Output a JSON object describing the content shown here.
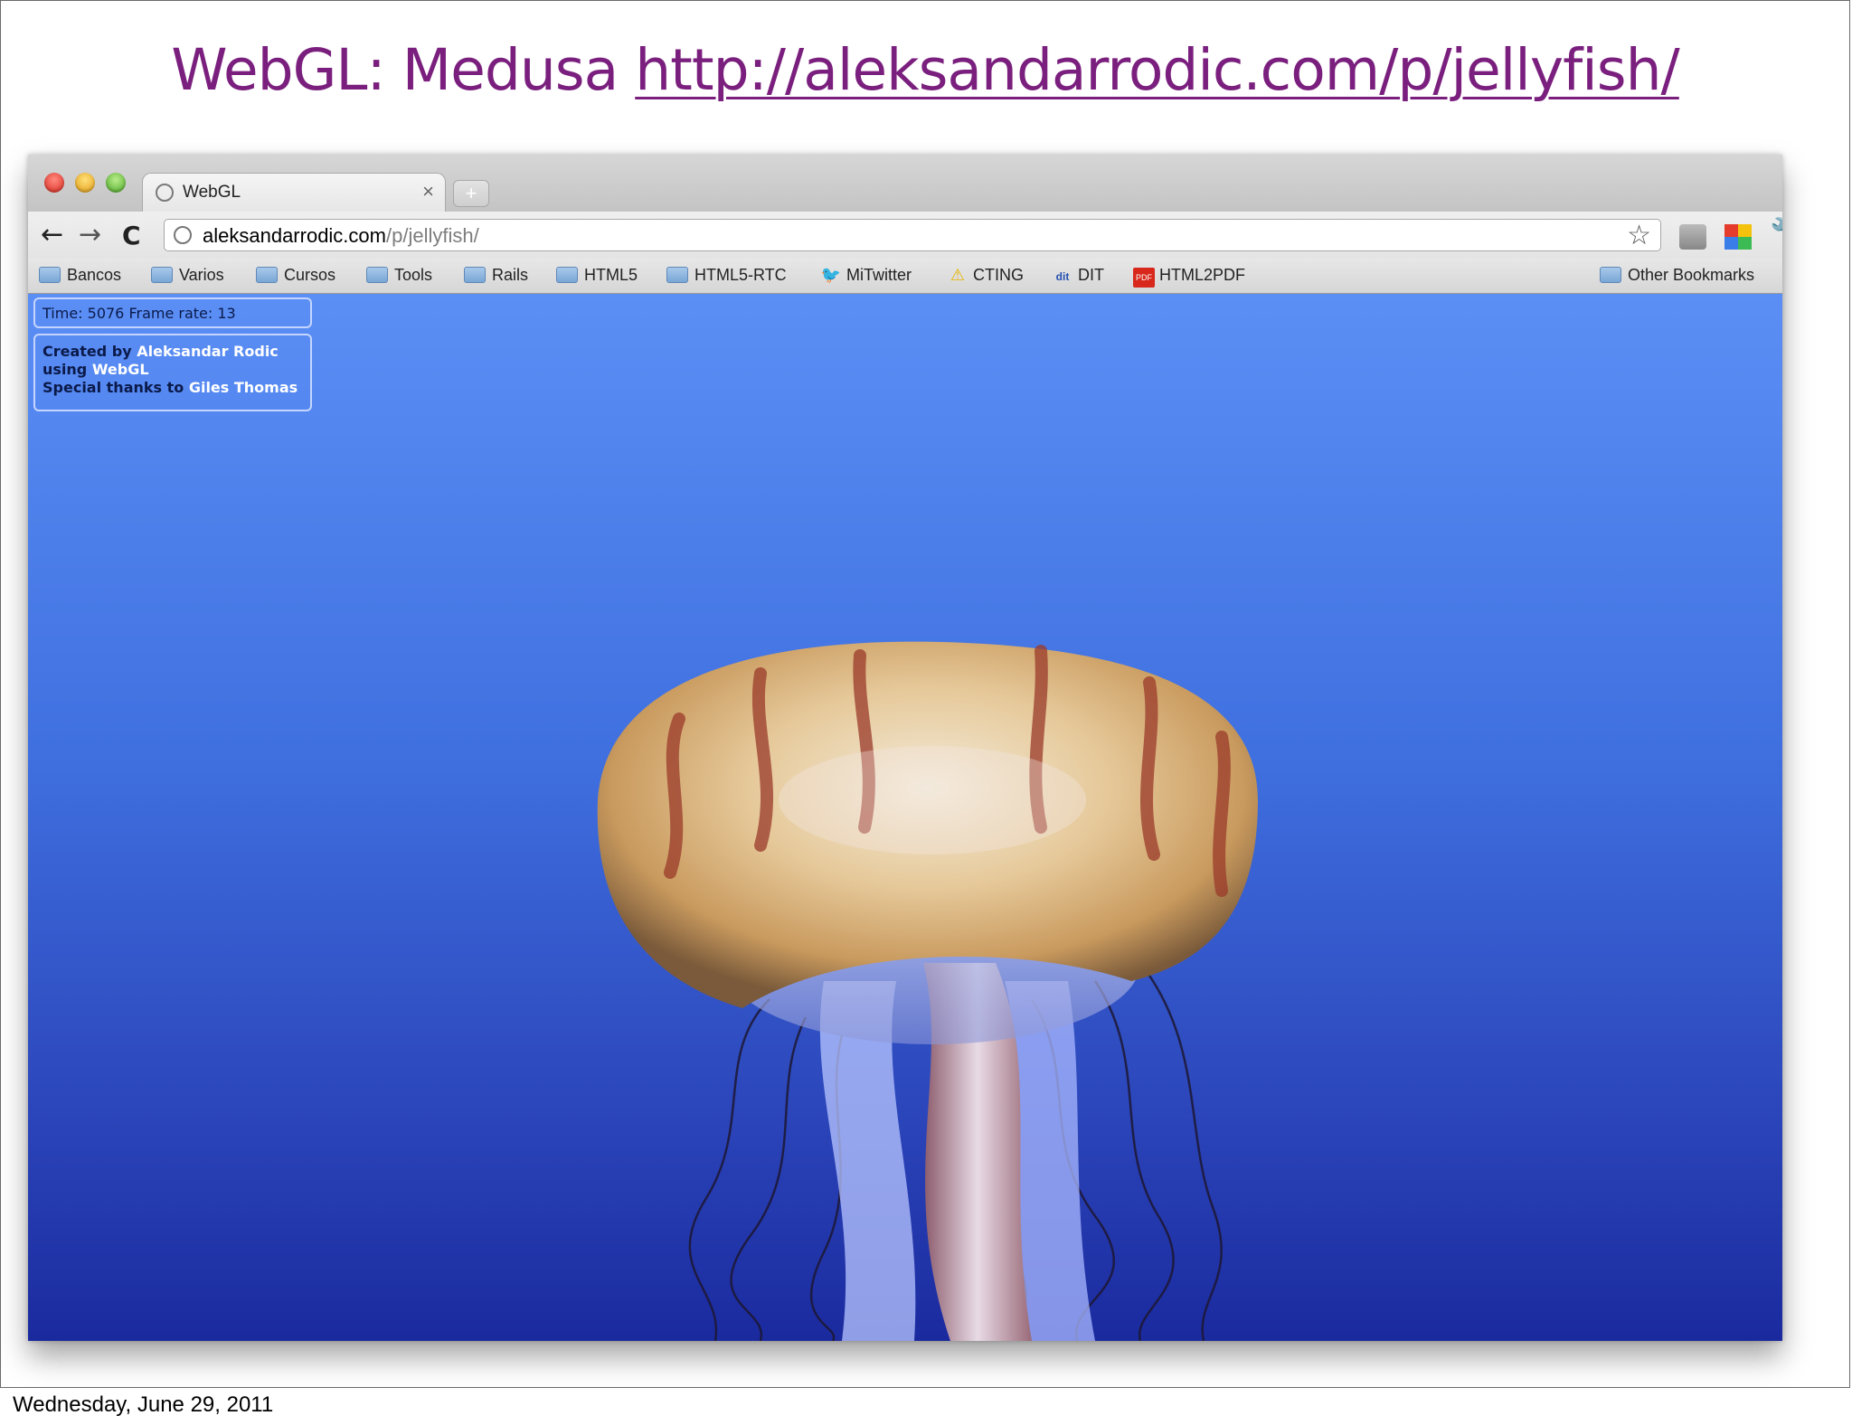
{
  "slide": {
    "title_prefix": "WebGL: Medusa",
    "title_link": "http://aleksandarrodic.com/p/jellyfish/",
    "footer_date": "Wednesday, June 29, 2011"
  },
  "browser": {
    "tab": {
      "title": "WebGL",
      "close": "×"
    },
    "new_tab": "+",
    "nav": {
      "back": "←",
      "forward": "→",
      "reload": "C"
    },
    "omnibox": {
      "domain": "aleksandarrodic.com",
      "path": "/p/jellyfish/"
    },
    "bookmarks": [
      {
        "label": "Bancos",
        "icon": "folder-icon"
      },
      {
        "label": "Varios",
        "icon": "folder-icon"
      },
      {
        "label": "Cursos",
        "icon": "folder-icon"
      },
      {
        "label": "Tools",
        "icon": "folder-icon"
      },
      {
        "label": "Rails",
        "icon": "folder-icon"
      },
      {
        "label": "HTML5",
        "icon": "folder-icon"
      },
      {
        "label": "HTML5-RTC",
        "icon": "folder-icon"
      },
      {
        "label": "MiTwitter",
        "icon": "twitter-bird-icon"
      },
      {
        "label": "CTING",
        "icon": "warning-icon"
      },
      {
        "label": "DIT",
        "icon": "dit-logo-icon"
      },
      {
        "label": "HTML2PDF",
        "icon": "pdf-icon"
      }
    ],
    "other_bookmarks": "Other Bookmarks"
  },
  "page": {
    "hud": {
      "time_label": "Time:",
      "time_value": "5076",
      "frame_rate_label": "Frame rate:",
      "frame_rate_value": "13"
    },
    "credits": {
      "created_by": "Created by",
      "author": "Aleksandar Rodic",
      "using": "using",
      "tech": "WebGL",
      "thanks": "Special thanks to",
      "thanks_name": "Giles Thomas"
    }
  },
  "colors": {
    "title": "#7a1f7e",
    "viewport_top": "#5b8ff5",
    "viewport_bottom": "#1a2a9e"
  }
}
